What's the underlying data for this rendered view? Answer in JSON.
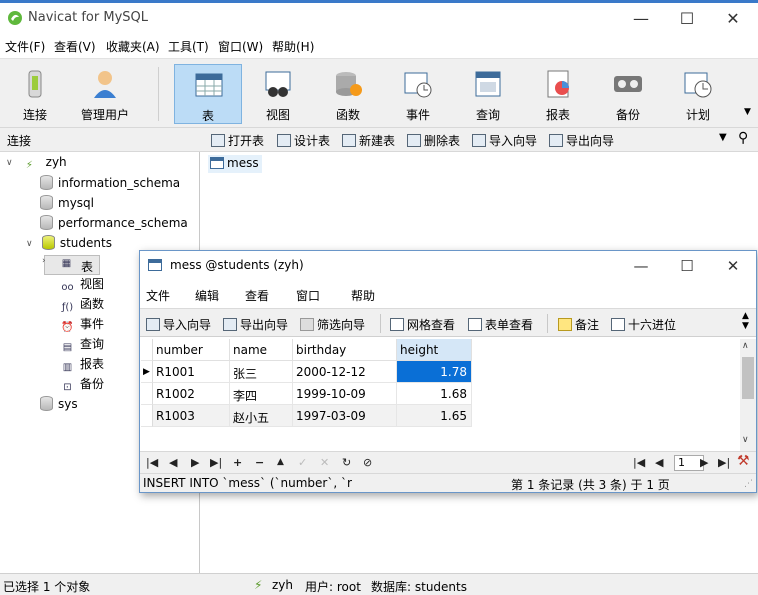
{
  "app": {
    "title": "Navicat for MySQL"
  },
  "menu": [
    "文件(F)",
    "查看(V)",
    "收藏夹(A)",
    "工具(T)",
    "窗口(W)",
    "帮助(H)"
  ],
  "toolbar": [
    {
      "label": "连接",
      "icon": "connection-icon"
    },
    {
      "label": "管理用户",
      "icon": "user-icon"
    },
    {
      "label": "表",
      "icon": "table-icon"
    },
    {
      "label": "视图",
      "icon": "view-icon"
    },
    {
      "label": "函数",
      "icon": "function-icon"
    },
    {
      "label": "事件",
      "icon": "event-icon"
    },
    {
      "label": "查询",
      "icon": "query-icon"
    },
    {
      "label": "报表",
      "icon": "report-icon"
    },
    {
      "label": "备份",
      "icon": "backup-icon"
    },
    {
      "label": "计划",
      "icon": "schedule-icon"
    }
  ],
  "subbar": {
    "left_label": "连接",
    "items": [
      "打开表",
      "设计表",
      "新建表",
      "删除表",
      "导入向导",
      "导出向导"
    ]
  },
  "tree": {
    "connection": "zyh",
    "databases": [
      "information_schema",
      "mysql",
      "performance_schema",
      "students",
      "sys"
    ],
    "categories": [
      "表",
      "视图",
      "函数",
      "事件",
      "查询",
      "报表",
      "备份"
    ],
    "category_glyphs": [
      "▦",
      "oo",
      "ƒ()",
      "⏰",
      "▤",
      "▥",
      "⊡"
    ]
  },
  "objects": [
    "mess"
  ],
  "inner": {
    "title": "mess @students (zyh)",
    "menu": [
      "文件",
      "编辑",
      "查看",
      "窗口",
      "帮助"
    ],
    "tools": [
      "导入向导",
      "导出向导",
      "筛选向导",
      "网格查看",
      "表单查看",
      "备注",
      "十六进位"
    ],
    "columns": [
      "number",
      "name",
      "birthday",
      "height"
    ],
    "rows": [
      [
        "R1001",
        "张三",
        "2000-12-12",
        "1.78"
      ],
      [
        "R1002",
        "李四",
        "1999-10-09",
        "1.68"
      ],
      [
        "R1003",
        "赵小五",
        "1997-03-09",
        "1.65"
      ]
    ],
    "nav_glyphs": [
      "|◀",
      "◀",
      "▶",
      "▶|",
      "+",
      "−",
      "▲",
      "✓",
      "✕",
      "↻",
      "⊘"
    ],
    "page_glyphs": [
      "|◀",
      "◀",
      "▶",
      "▶|"
    ],
    "page_number": "1",
    "sql": "INSERT INTO `mess` (`number`, `r",
    "record_info": "第 1 条记录 (共 3 条) 于 1 页"
  },
  "status": {
    "selection": "已选择 1 个对象",
    "connection": "zyh",
    "user": "用户: root",
    "database": "数据库: students"
  },
  "colors": {
    "accent": "#0a6fd6",
    "selected_tool": "#bcdcf6"
  }
}
